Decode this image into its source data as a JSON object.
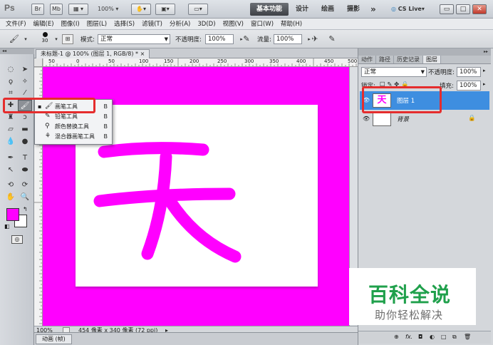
{
  "app": {
    "logo": "Ps",
    "title_buttons": [
      "Br",
      "Mb"
    ],
    "zoom": "100%",
    "workspaces": [
      "基本功能",
      "设计",
      "绘画",
      "摄影"
    ],
    "more": "»",
    "cs_live": "CS Live",
    "window_controls": [
      "▭",
      "□",
      "✕"
    ]
  },
  "menu": {
    "items": [
      "文件(F)",
      "编辑(E)",
      "图像(I)",
      "图层(L)",
      "选择(S)",
      "滤镜(T)",
      "分析(A)",
      "3D(D)",
      "视图(V)",
      "窗口(W)",
      "帮助(H)"
    ]
  },
  "options": {
    "brush_size": "30",
    "mode_label": "模式:",
    "mode_value": "正常",
    "opacity_label": "不透明度:",
    "opacity_value": "100%",
    "flow_label": "流量:",
    "flow_value": "100%"
  },
  "flyout": {
    "items": [
      {
        "label": "画笔工具",
        "key": "B",
        "active": true
      },
      {
        "label": "铅笔工具",
        "key": "B",
        "active": false
      },
      {
        "label": "颜色替换工具",
        "key": "B",
        "active": false
      },
      {
        "label": "混合器画笔工具",
        "key": "B",
        "active": false
      }
    ]
  },
  "document": {
    "tab_title": "未标题-1 @ 100% (图层 1, RGB/8) *",
    "ruler_ticks": [
      "50",
      "0",
      "50",
      "100",
      "150",
      "200",
      "250",
      "300",
      "350",
      "400",
      "450",
      "500"
    ],
    "canvas_char": "天",
    "status_zoom": "100%",
    "status_info": "454 像素 x 340 像素 (72 ppi)",
    "bottom_tab": "动画 (帧)",
    "colors": {
      "canvas": "#ff00ff",
      "paper": "#ffffff",
      "stroke": "#ff00ff"
    }
  },
  "panel": {
    "tabs": [
      "动作",
      "路径",
      "历史记录",
      "图层"
    ],
    "blend_mode": "正常",
    "opacity_label": "不透明度:",
    "opacity_value": "100%",
    "lock_label": "锁定:",
    "fill_label": "填充:",
    "fill_value": "100%",
    "layers": [
      {
        "name": "图层 1",
        "thumb_char": "天",
        "selected": true
      },
      {
        "name": "背景",
        "thumb_char": "",
        "selected": false
      }
    ],
    "bottom_icons": [
      "link-icon",
      "fx-icon",
      "mask-icon",
      "adjust-icon",
      "folder-icon",
      "new-layer-icon",
      "trash-icon"
    ],
    "bottom_glyphs": [
      "⊕",
      "fx.",
      "◘",
      "◐",
      "□",
      "⧉",
      "🗑"
    ]
  },
  "watermark": {
    "title": "百科全说",
    "subtitle": "助你轻松解决",
    "color": "#1fa04b"
  },
  "accent": {
    "highlight": "#e52d2d",
    "selection": "#3e8ee0",
    "foreground": "#ff00ff",
    "background": "#ffffff"
  }
}
